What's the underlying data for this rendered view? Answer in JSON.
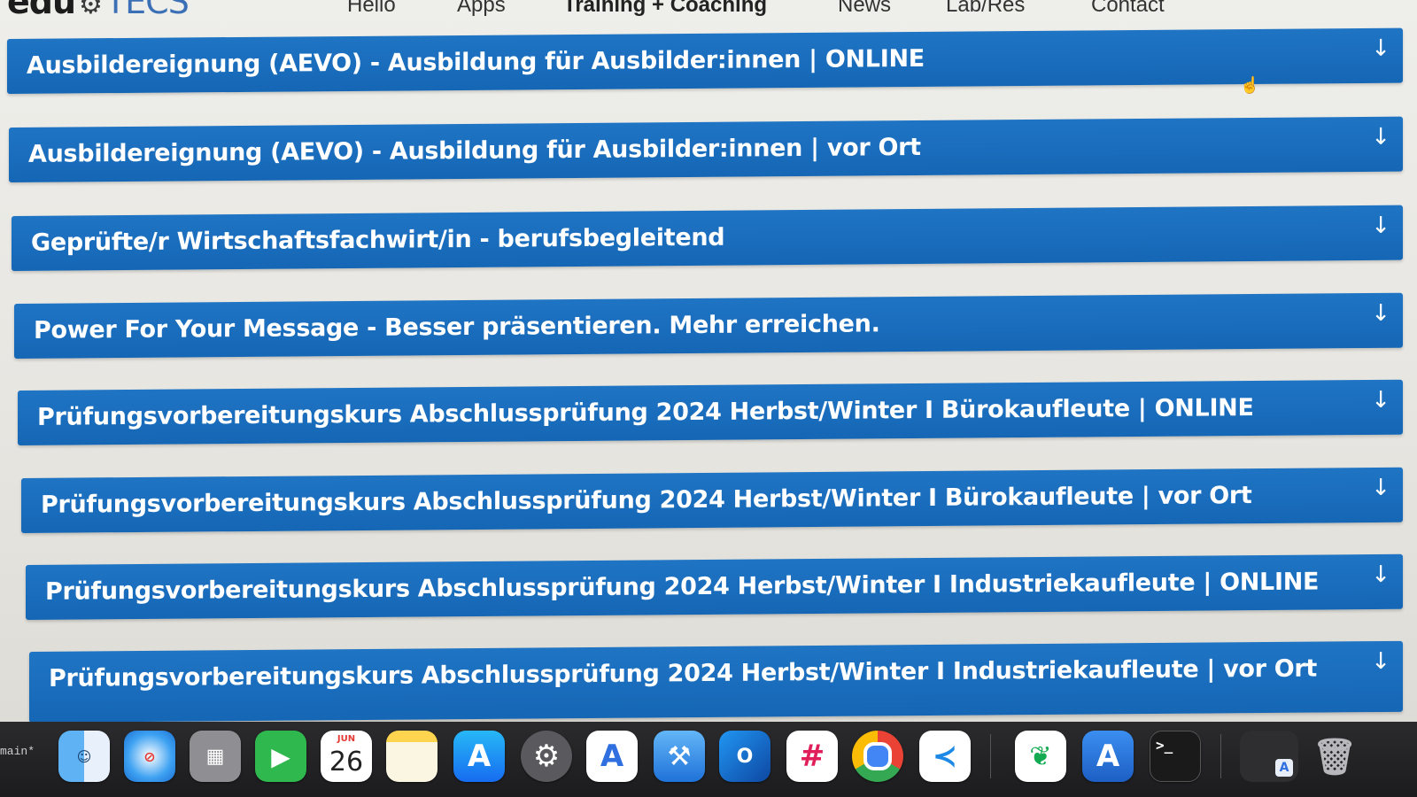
{
  "nav": {
    "logo_text": "edu",
    "logo_tail": "TECS",
    "items": [
      "Hello",
      "Apps",
      "Training + Coaching",
      "News",
      "Lab/Res",
      "Contact"
    ]
  },
  "accordion": [
    {
      "title": "Ausbildereignung (AEVO) - Ausbildung für Ausbilder:innen | ONLINE"
    },
    {
      "title": "Ausbildereignung (AEVO) - Ausbildung für Ausbilder:innen | vor Ort"
    },
    {
      "title": "Geprüfte/r Wirtschaftsfachwirt/in - berufsbegleitend"
    },
    {
      "title": "Power For Your Message - Besser präsentieren. Mehr erreichen."
    },
    {
      "title": "Prüfungsvorbereitungskurs Abschlussprüfung 2024 Herbst/Winter I Bürokaufleute | ONLINE"
    },
    {
      "title": "Prüfungsvorbereitungskurs Abschlussprüfung 2024 Herbst/Winter I Bürokaufleute | vor Ort"
    },
    {
      "title": "Prüfungsvorbereitungskurs Abschlussprüfung 2024 Herbst/Winter I Industriekaufleute | ONLINE"
    },
    {
      "title": "Prüfungsvorbereitungskurs Abschlussprüfung 2024 Herbst/Winter I Industriekaufleute | vor Ort"
    }
  ],
  "arrow_glyph": "↓",
  "dock": {
    "branch": "main*",
    "calendar_month": "JUN",
    "calendar_day": "26",
    "apps": [
      "finder-icon",
      "safari-icon",
      "launchpad-icon",
      "facetime-icon",
      "calendar-icon",
      "notes-icon",
      "app-store-icon",
      "system-settings-icon",
      "instruments-icon",
      "xcode-icon",
      "outlook-icon",
      "slack-icon",
      "chrome-icon",
      "vscode-icon",
      "mongodb-compass-icon",
      "app-store-connect-icon",
      "terminal-icon",
      "downloads-icon",
      "trash-icon"
    ]
  },
  "colors": {
    "accordion_blue": "#1a6dbd",
    "page_bg": "#ecebe7",
    "dock_bg": "#232325"
  }
}
